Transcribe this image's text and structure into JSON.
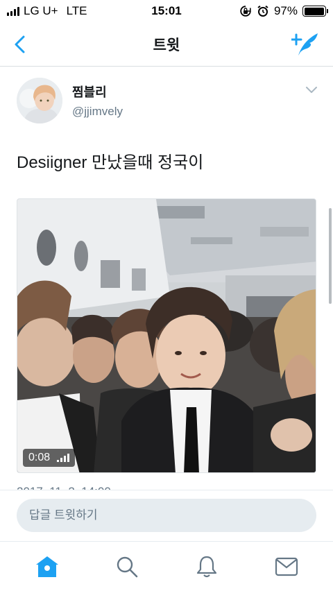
{
  "status_bar": {
    "carrier": "LG U+",
    "network": "LTE",
    "time": "15:01",
    "battery": "97%",
    "battery_level": 0.97,
    "icons": [
      "signal-icon",
      "rotation-lock-icon",
      "alarm-icon",
      "battery-icon"
    ]
  },
  "nav": {
    "title": "트윗",
    "back_icon": "back-chevron-icon",
    "compose_icon": "compose-tweet-icon"
  },
  "tweet": {
    "author_name": "찜블리",
    "author_handle": "@jjimvely",
    "text": "Desiigner 만났을때 정국이",
    "video_duration": "0:08",
    "timestamp_partial": "2017. 11. 2. 14:00"
  },
  "reply": {
    "placeholder": "답글 트윗하기"
  },
  "tabs": [
    {
      "icon": "home-icon",
      "active": true
    },
    {
      "icon": "search-icon",
      "active": false
    },
    {
      "icon": "notifications-bell-icon",
      "active": false
    },
    {
      "icon": "messages-envelope-icon",
      "active": false
    }
  ],
  "colors": {
    "accent": "#1da1f2",
    "text": "#14171a",
    "secondary": "#657786",
    "divider": "#d8dde1",
    "input_bg": "#e6ecf0"
  }
}
